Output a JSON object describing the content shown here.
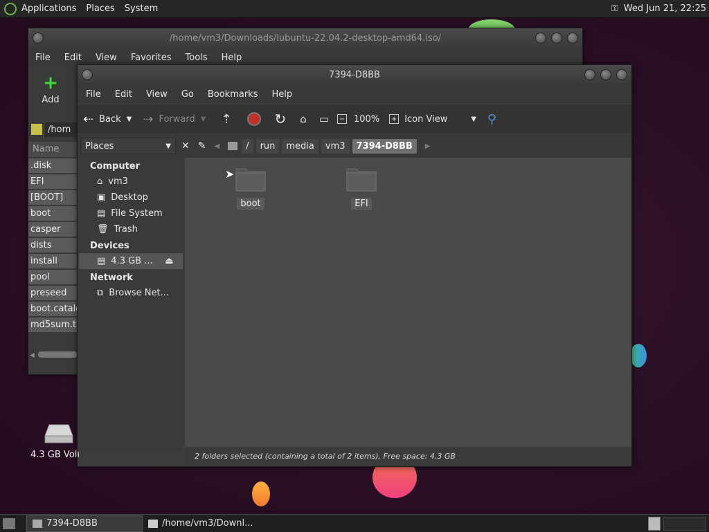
{
  "top_panel": {
    "menus": [
      "Applications",
      "Places",
      "System"
    ],
    "clock": "Wed Jun 21, 22:25"
  },
  "back_window": {
    "title": "/home/vm3/Downloads/lubuntu-22.04.2-desktop-amd64.iso/",
    "menus": [
      "File",
      "Edit",
      "View",
      "Favorites",
      "Tools",
      "Help"
    ],
    "add_label": "Add",
    "path_value": "/hom",
    "column_header": "Name",
    "files": [
      ".disk",
      "EFI",
      "[BOOT]",
      "boot",
      "casper",
      "dists",
      "install",
      "pool",
      "preseed",
      "boot.catalog",
      "md5sum.txt"
    ]
  },
  "front_window": {
    "title": "7394-D8BB",
    "menus": [
      "File",
      "Edit",
      "View",
      "Go",
      "Bookmarks",
      "Help"
    ],
    "toolbar": {
      "back": "Back",
      "forward": "Forward",
      "zoom": "100%",
      "view_mode": "Icon View"
    },
    "places_combo": "Places",
    "breadcrumbs": [
      "/",
      "run",
      "media",
      "vm3",
      "7394-D8BB"
    ],
    "sidebar": {
      "computer_header": "Computer",
      "computer_items": [
        "vm3",
        "Desktop",
        "File System",
        "Trash"
      ],
      "devices_header": "Devices",
      "device_item": "4.3 GB ...",
      "network_header": "Network",
      "network_item": "Browse Net..."
    },
    "folders": [
      "boot",
      "EFI"
    ],
    "status": "2 folders selected (containing a total of 2 items), Free space: 4.3 GB"
  },
  "desktop_icon": "4.3 GB Volu",
  "taskbar": {
    "items": [
      "7394-D8BB",
      "/home/vm3/Downl..."
    ]
  },
  "colors": {
    "panel": "#262626",
    "desktop": "#2b0f25",
    "selected": "#707070"
  }
}
